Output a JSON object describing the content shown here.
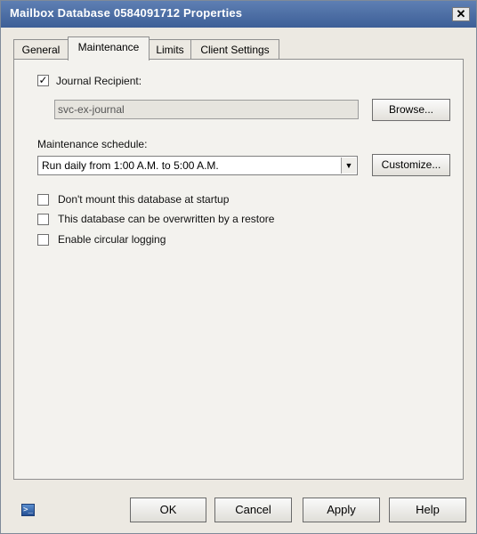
{
  "window": {
    "title": "Mailbox Database 0584091712 Properties",
    "close_glyph": "✕"
  },
  "tabs": [
    {
      "label": "General"
    },
    {
      "label": "Maintenance",
      "active": true
    },
    {
      "label": "Limits"
    },
    {
      "label": "Client Settings"
    }
  ],
  "maintenance": {
    "journal": {
      "label": "Journal Recipient:",
      "checked": true,
      "value": "svc-ex-journal",
      "browse_label": "Browse..."
    },
    "schedule": {
      "label": "Maintenance schedule:",
      "value": "Run daily from 1:00 A.M. to 5:00 A.M.",
      "customize_label": "Customize..."
    },
    "options": [
      {
        "label": "Don't mount this database at startup",
        "checked": false
      },
      {
        "label": "This database can be overwritten by a restore",
        "checked": false
      },
      {
        "label": "Enable circular logging",
        "checked": false
      }
    ]
  },
  "footer": {
    "ok": "OK",
    "cancel": "Cancel",
    "apply": "Apply",
    "help": "Help",
    "icon": "powershell-icon"
  },
  "colors": {
    "titlebar": "#4a6ea6",
    "dialog_bg": "#ece9e2",
    "panel_bg": "#f3f2ee"
  }
}
